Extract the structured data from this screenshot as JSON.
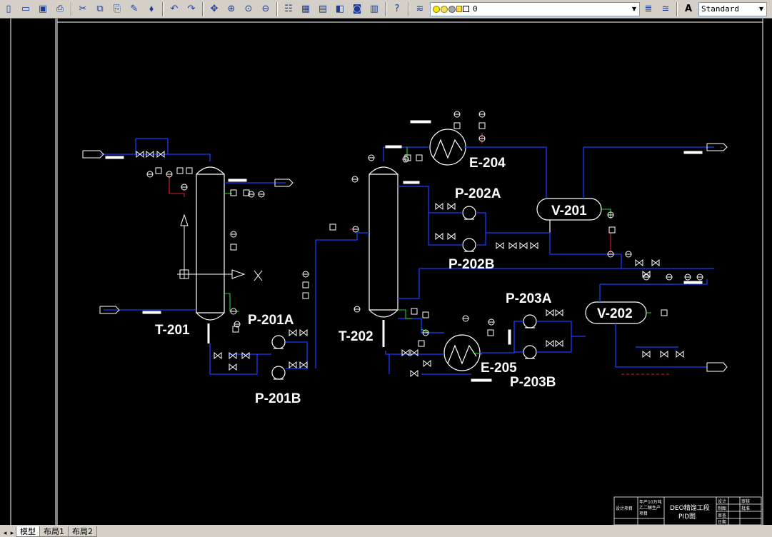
{
  "toolbar": {
    "buttons": [
      {
        "name": "new-drawing-button",
        "icon": "new-icon",
        "glyph": "▯"
      },
      {
        "name": "open-button",
        "icon": "open-folder-icon",
        "glyph": "▭"
      },
      {
        "name": "save-button",
        "icon": "save-icon",
        "glyph": "▣"
      },
      {
        "name": "plot-button",
        "icon": "printer-icon",
        "glyph": "⎙"
      },
      {
        "name": "cut-button",
        "icon": "scissors-icon",
        "glyph": "✂"
      },
      {
        "name": "copy-button",
        "icon": "copy-icon",
        "glyph": "⧉"
      },
      {
        "name": "paste-button",
        "icon": "clipboard-icon",
        "glyph": "⎘"
      },
      {
        "name": "match-properties-button",
        "icon": "brush-icon",
        "glyph": "✎"
      },
      {
        "name": "block-editor-button",
        "icon": "block-icon",
        "glyph": "⬧"
      },
      {
        "name": "undo-button",
        "icon": "undo-icon",
        "glyph": "↶"
      },
      {
        "name": "redo-button",
        "icon": "redo-icon",
        "glyph": "↷"
      },
      {
        "name": "pan-button",
        "icon": "pan-icon",
        "glyph": "✥"
      },
      {
        "name": "zoom-realtime-button",
        "icon": "zoom-icon",
        "glyph": "⊕"
      },
      {
        "name": "zoom-window-button",
        "icon": "zoom-window-icon",
        "glyph": "⊙"
      },
      {
        "name": "zoom-previous-button",
        "icon": "zoom-previous-icon",
        "glyph": "⊖"
      },
      {
        "name": "properties-button",
        "icon": "properties-icon",
        "glyph": "☷"
      },
      {
        "name": "design-center-button",
        "icon": "grid-icon",
        "glyph": "▦"
      },
      {
        "name": "tool-palettes-button",
        "icon": "palette-icon",
        "glyph": "▤"
      },
      {
        "name": "sheet-set-button",
        "icon": "sheet-icon",
        "glyph": "◧"
      },
      {
        "name": "markup-button",
        "icon": "markup-icon",
        "glyph": "◙"
      },
      {
        "name": "calculator-button",
        "icon": "calculator-icon",
        "glyph": "▥"
      },
      {
        "name": "help-button",
        "icon": "help-icon",
        "glyph": "?"
      }
    ],
    "layer_value": "0",
    "text_style_value": "Standard"
  },
  "tabs": [
    {
      "label": "模型",
      "active": true
    },
    {
      "label": "布局1",
      "active": false
    },
    {
      "label": "布局2",
      "active": false
    }
  ],
  "equipment": {
    "t201": "T-201",
    "t202": "T-202",
    "p201a": "P-201A",
    "p201b": "P-201B",
    "p202a": "P-202A",
    "p202b": "P-202B",
    "p203a": "P-203A",
    "p203b": "P-203B",
    "e204": "E-204",
    "e205": "E-205",
    "v201": "V-201",
    "v202": "V-202"
  },
  "title_block": {
    "design_project": "设计项目",
    "company": "年产10万吨",
    "product": "乙二醇生产",
    "project": "项目",
    "title_line1": "DEO精馏工段",
    "title_line2": "PID图",
    "role_design": "设计",
    "role_check": "审核",
    "role_draw": "制图",
    "role_approve": "批准",
    "role_review": "审查",
    "role_date": "日期"
  },
  "colors": {
    "canvas": "#000000",
    "pipe": "#1a3cff",
    "signal_green": "#2bd12b",
    "signal_red": "#e02020",
    "line_white": "#ffffff"
  }
}
